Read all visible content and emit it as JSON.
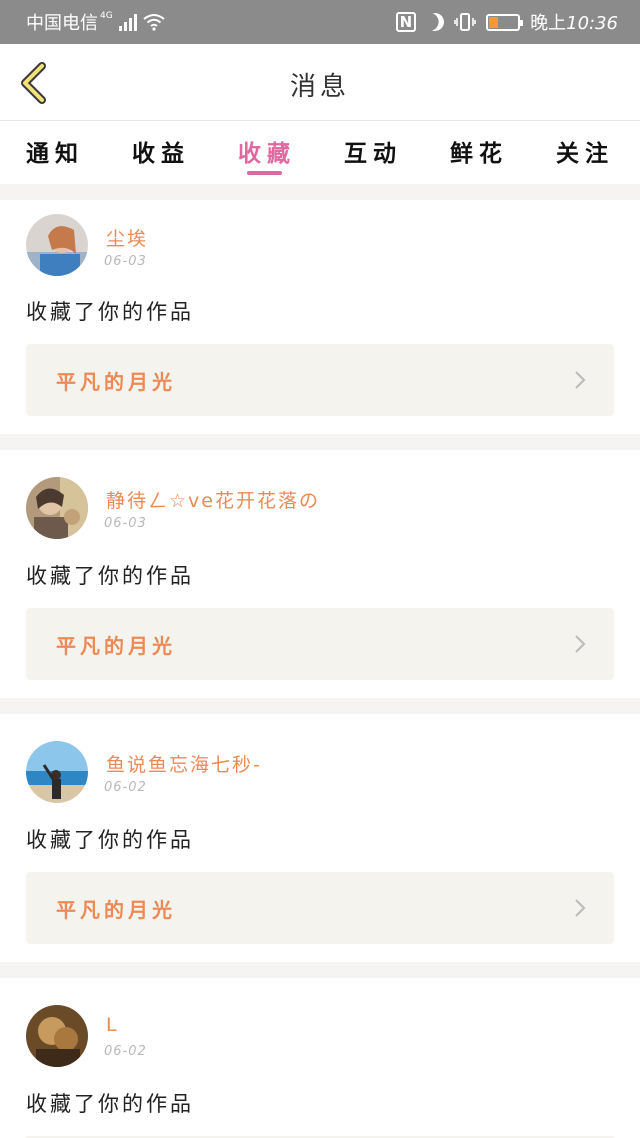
{
  "status_bar": {
    "carrier": "中国电信",
    "network": "4G",
    "time_prefix": "晚上",
    "time": "10:36",
    "nfc": "N",
    "battery_level": 0.3,
    "bar_color": "#8b8b8b"
  },
  "header": {
    "title": "消息"
  },
  "tabs": [
    {
      "label": "通知"
    },
    {
      "label": "收益"
    },
    {
      "label": "收藏"
    },
    {
      "label": "互动"
    },
    {
      "label": "鲜花"
    },
    {
      "label": "关注"
    }
  ],
  "active_tab": "收藏",
  "colors": {
    "accent_pink": "#e0679f",
    "username_orange": "#ec8a55",
    "work_bg": "#f4f3ee"
  },
  "messages": [
    {
      "username": "尘埃",
      "date": "06-03",
      "action": "收藏了你的作品",
      "work_title": "平凡的月光"
    },
    {
      "username": "静待ㄥ☆ve花开花落の",
      "date": "06-03",
      "action": "收藏了你的作品",
      "work_title": "平凡的月光"
    },
    {
      "username": "鱼说鱼忘海七秒-",
      "date": "06-02",
      "action": "收藏了你的作品",
      "work_title": "平凡的月光"
    },
    {
      "username": "L",
      "date": "06-02",
      "action": "收藏了你的作品",
      "work_title": ""
    }
  ]
}
